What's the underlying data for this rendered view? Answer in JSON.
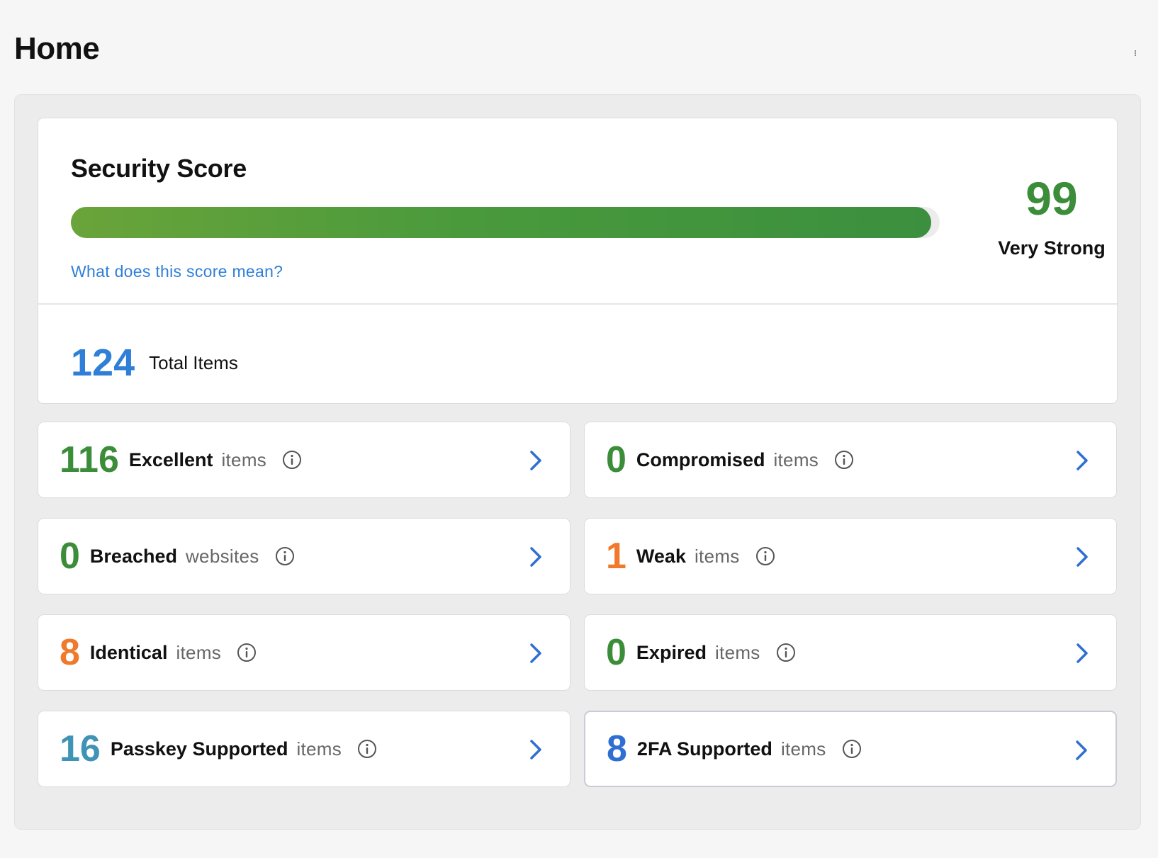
{
  "page": {
    "title": "Home"
  },
  "score": {
    "title": "Security Score",
    "value": "99",
    "label": "Very Strong",
    "progress_percent": 99,
    "link_text": "What does this score mean?"
  },
  "total": {
    "count": "124",
    "label": "Total Items"
  },
  "stats": [
    {
      "count": "116",
      "name": "Excellent",
      "unit": "items",
      "color": "#3c8d3a"
    },
    {
      "count": "0",
      "name": "Compromised",
      "unit": "items",
      "color": "#3c8d3a"
    },
    {
      "count": "0",
      "name": "Breached",
      "unit": "websites",
      "color": "#3c8d3a"
    },
    {
      "count": "1",
      "name": "Weak",
      "unit": "items",
      "color": "#ef7a2c"
    },
    {
      "count": "8",
      "name": "Identical",
      "unit": "items",
      "color": "#ef7a2c"
    },
    {
      "count": "0",
      "name": "Expired",
      "unit": "items",
      "color": "#3c8d3a"
    },
    {
      "count": "16",
      "name": "Passkey Supported",
      "unit": "items",
      "color": "#3f93b5"
    },
    {
      "count": "8",
      "name": "2FA Supported",
      "unit": "items",
      "color": "#2f6fd1"
    }
  ],
  "colors": {
    "accent": "#2f7fd8",
    "good": "#3c8d3a",
    "warn": "#ef7a2c"
  },
  "icons": {
    "info": "info-circle-icon",
    "chevron": "chevron-right-icon",
    "menu": "kebab-menu-icon"
  }
}
